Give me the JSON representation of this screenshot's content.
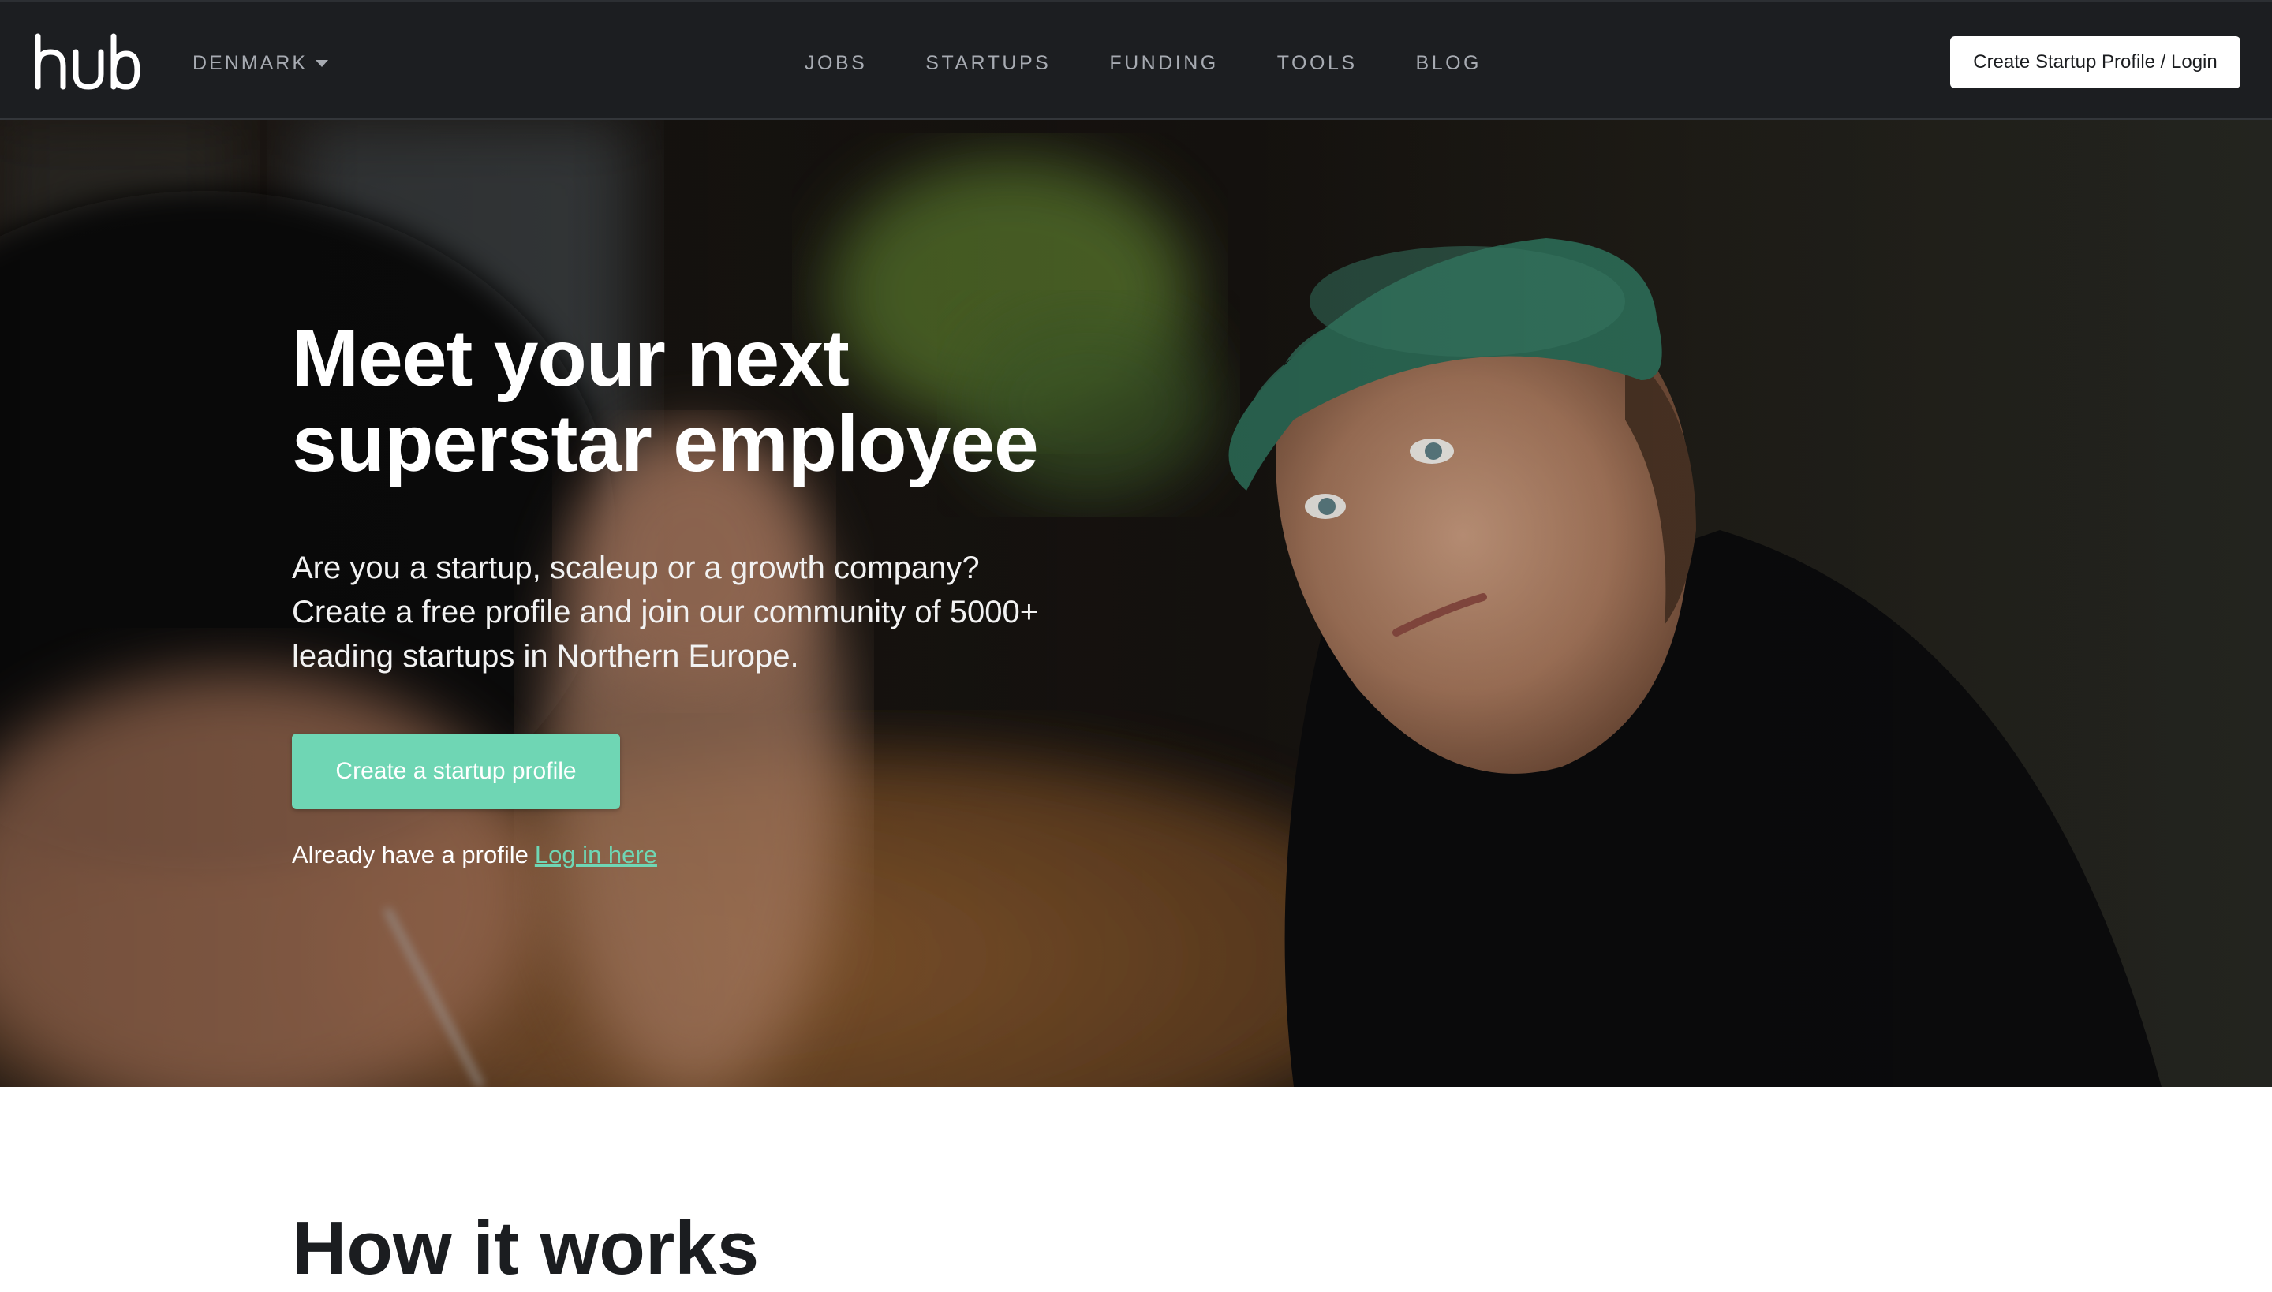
{
  "navbar": {
    "logo_text": "hub",
    "country": "DENMARK",
    "links": [
      "JOBS",
      "STARTUPS",
      "FUNDING",
      "TOOLS",
      "BLOG"
    ],
    "login_button": "Create Startup Profile / Login",
    "background_color": "#1c1e21"
  },
  "hero": {
    "title_line1": "Meet your next",
    "title_line2": "superstar employee",
    "subtitle_line1": "Are you a startup, scaleup or a growth company?",
    "subtitle_line2": "Create a free profile and join our community of 5000+",
    "subtitle_line3": "leading startups in Northern Europe.",
    "cta_label": "Create a startup profile",
    "already_text": "Already have a profile",
    "login_link": "Log in here",
    "accent_color": "#6fd6b4"
  },
  "section": {
    "title": "How it works"
  },
  "icons": {
    "country_toggle": "chevron-down-icon"
  }
}
